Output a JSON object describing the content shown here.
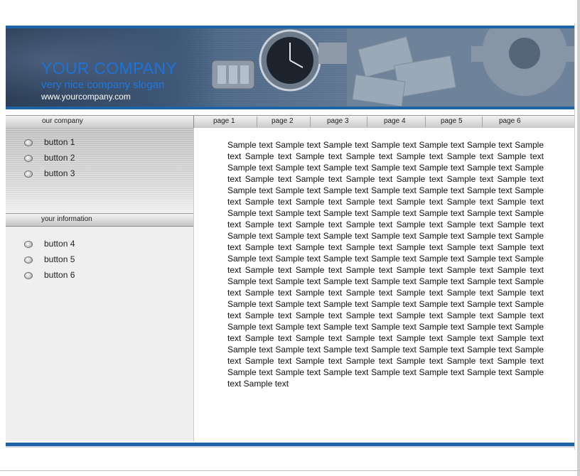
{
  "header": {
    "company_name": "YOUR COMPANY",
    "slogan": "very nice company slogan",
    "url": "www.yourcompany.com"
  },
  "nav": {
    "section_label": "our company",
    "tabs": [
      "page 1",
      "page 2",
      "page 3",
      "page 4",
      "page 5",
      "page 6"
    ]
  },
  "sidebar": {
    "group1": [
      "button 1",
      "button 2",
      "button 3"
    ],
    "info_label": "your information",
    "group2": [
      "button 4",
      "button 5",
      "button 6"
    ]
  },
  "content": {
    "text": "Sample text Sample text Sample text Sample text Sample text Sample text Sample text Sample text Sample text Sample text Sample text Sample text Sample text Sample text Sample text Sample text Sample text Sample text Sample text Sample text Sample text Sample text Sample text Sample text Sample text Sample text Sample text Sample text Sample text Sample text Sample text Sample text Sample text Sample text Sample text Sample text Sample text Sample text Sample text Sample text Sample text Sample text Sample text Sample text Sample text Sample text Sample text Sample text Sample text Sample text Sample text Sample text Sample text Sample text Sample text Sample text Sample text Sample text Sample text Sample text Sample text Sample text Sample text Sample text Sample text Sample text Sample text Sample text Sample text Sample text Sample text Sample text Sample text Sample text Sample text Sample text Sample text Sample text Sample text Sample text Sample text Sample text Sample text Sample text Sample text Sample text Sample text Sample text Sample text Sample text Sample text Sample text Sample text Sample text Sample text Sample text Sample text Sample text Sample text Sample text Sample text Sample text Sample text Sample text Sample text Sample text Sample text Sample text Sample text Sample text Sample text Sample text Sample text Sample text Sample text Sample text Sample text Sample text Sample text Sample text Sample text Sample text Sample text Sample text Sample text Sample text Sample text Sample text Sample text Sample text Sample text Sample text Sample text Sample text Sample text Sample text Sample text Sample text"
  },
  "colors": {
    "accent_blue": "#1d63a8",
    "company_name_blue": "#1e73d9"
  }
}
